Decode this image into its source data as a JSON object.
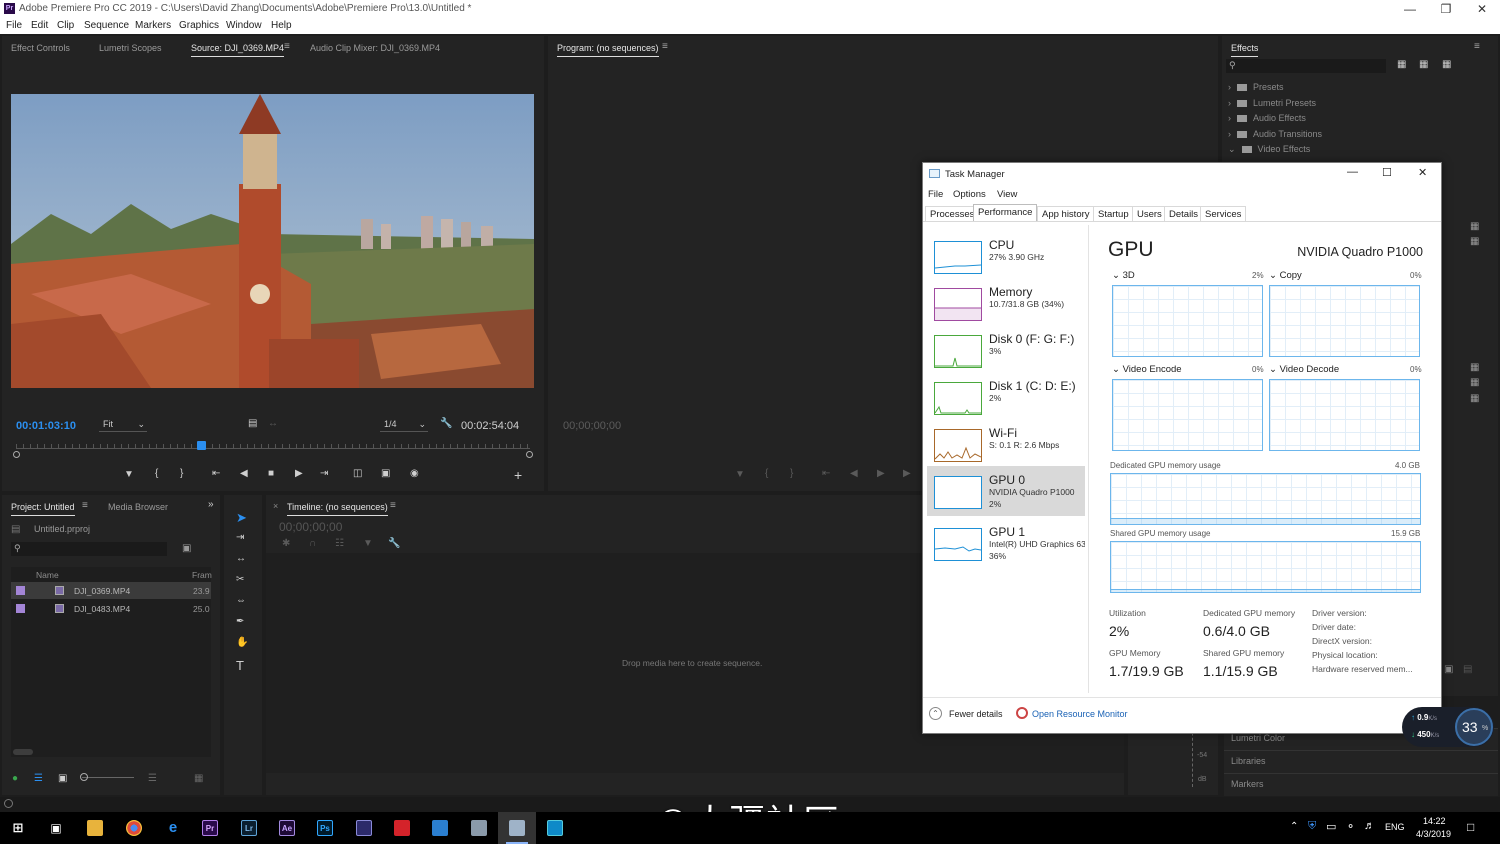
{
  "window": {
    "title": "Adobe Premiere Pro CC 2019 - C:\\Users\\David Zhang\\Documents\\Adobe\\Premiere Pro\\13.0\\Untitled *",
    "app_icon": "Pr"
  },
  "menu": [
    "File",
    "Edit",
    "Clip",
    "Sequence",
    "Markers",
    "Graphics",
    "Window",
    "Help"
  ],
  "source_panel": {
    "tabs": [
      "Effect Controls",
      "Lumetri Scopes",
      "Source: DJI_0369.MP4",
      "Audio Clip Mixer: DJI_0369.MP4"
    ],
    "timecode": "00:01:03:10",
    "zoom": "Fit",
    "resolution": "1/4",
    "duration": "00:02:54:04",
    "playhead_fraction": 0.36
  },
  "program_panel": {
    "tab": "Program: (no sequences)",
    "timecode": "00;00;00;00"
  },
  "effects_panel": {
    "tab": "Effects",
    "items": [
      "Presets",
      "Lumetri Presets",
      "Audio Effects",
      "Audio Transitions",
      "Video Effects"
    ],
    "bottom_items": [
      "Lumetri Color",
      "Libraries",
      "Markers"
    ]
  },
  "project_panel": {
    "tabs": [
      "Project: Untitled",
      "Media Browser"
    ],
    "project_file": "Untitled.prproj",
    "columns": [
      "Name",
      "Fram"
    ],
    "rows": [
      {
        "name": "DJI_0369.MP4",
        "fps": "23.9"
      },
      {
        "name": "DJI_0483.MP4",
        "fps": "25.0"
      }
    ]
  },
  "timeline_panel": {
    "tab": "Timeline: (no sequences)",
    "timecode": "00;00;00;00",
    "empty_msg": "Drop media here to create sequence."
  },
  "audio_meter": {
    "labels": [
      "-54",
      "dB"
    ]
  },
  "task_manager": {
    "title": "Task Manager",
    "menu": [
      "File",
      "Options",
      "View"
    ],
    "tabs": [
      "Processes",
      "Performance",
      "App history",
      "Startup",
      "Users",
      "Details",
      "Services"
    ],
    "sidebar": [
      {
        "name": "CPU",
        "sub": "27% 3.90 GHz",
        "color": "#1e90d6"
      },
      {
        "name": "Memory",
        "sub": "10.7/31.8 GB (34%)",
        "color": "#a04aa0"
      },
      {
        "name": "Disk 0 (F: G: F:)",
        "sub": "3%",
        "color": "#4aa83c"
      },
      {
        "name": "Disk 1 (C: D: E:)",
        "sub": "2%",
        "color": "#4aa83c"
      },
      {
        "name": "Wi-Fi",
        "sub": "S: 0.1  R: 2.6 Mbps",
        "color": "#a8682a"
      },
      {
        "name": "GPU 0",
        "sub": "NVIDIA Quadro P1000",
        "sub2": "2%",
        "color": "#1e90d6"
      },
      {
        "name": "GPU 1",
        "sub": "Intel(R) UHD Graphics 63",
        "sub2": "36%",
        "color": "#1e90d6"
      }
    ],
    "gpu": {
      "heading": "GPU",
      "model": "NVIDIA Quadro P1000",
      "graphs": [
        {
          "label": "3D",
          "pct": "2%"
        },
        {
          "label": "Copy",
          "pct": "0%"
        },
        {
          "label": "Video Encode",
          "pct": "0%"
        },
        {
          "label": "Video Decode",
          "pct": "0%"
        }
      ],
      "dedicated_label": "Dedicated GPU memory usage",
      "dedicated_max": "4.0 GB",
      "shared_label": "Shared GPU memory usage",
      "shared_max": "15.9 GB",
      "stats": {
        "utilization_label": "Utilization",
        "utilization": "2%",
        "dedicated_mem_label": "Dedicated GPU memory",
        "dedicated_mem": "0.6/4.0 GB",
        "gpu_mem_label": "GPU Memory",
        "gpu_mem": "1.7/19.9 GB",
        "shared_mem_label": "Shared GPU memory",
        "shared_mem": "1.1/15.9 GB"
      },
      "driver_info": [
        "Driver version:",
        "Driver date:",
        "DirectX version:",
        "Physical location:",
        "Hardware reserved mem..."
      ]
    },
    "fewer_details": "Fewer details",
    "resource_monitor": "Open Resource Monitor"
  },
  "net_widget": {
    "up": "0.9",
    "down": "450",
    "unit": "K/s",
    "percent": "33",
    "pct_sign": "%"
  },
  "watermark": "©大疆社区",
  "taskbar": {
    "apps": [
      "Pr",
      "Lr",
      "Ae",
      "Ps"
    ],
    "tray": {
      "lang": "ENG",
      "time": "14:22",
      "date": "4/3/2019"
    }
  }
}
